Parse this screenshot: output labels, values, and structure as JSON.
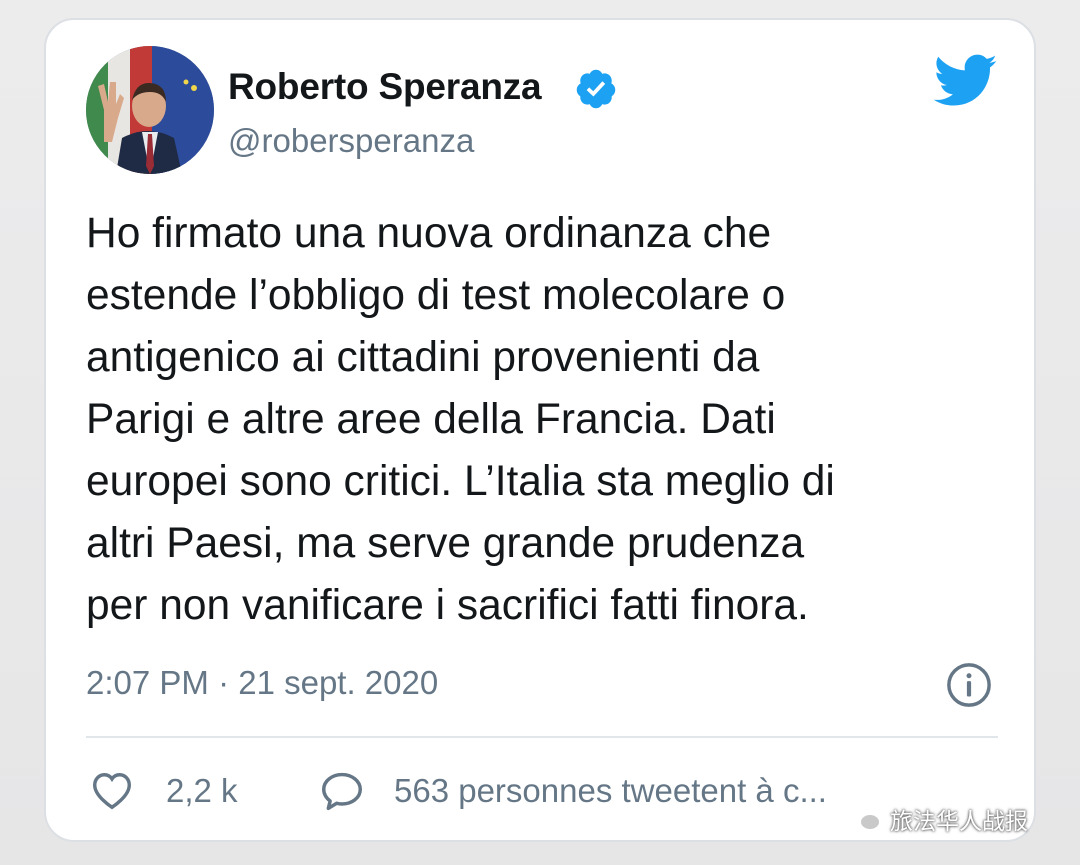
{
  "tweet": {
    "author_name": "Roberto Speranza",
    "handle": "@robersperanza",
    "text": "Ho firmato una nuova ordinanza che\nestende l’obbligo di test molecolare o\nantigenico ai cittadini provenienti da\nParigi e altre aree della Francia. Dati\neuropei sono critici. L’Italia sta meglio di\naltri Paesi, ma serve grande prudenza\nper non vanificare i sacrifici fatti finora.",
    "timestamp": "2:07 PM · 21 sept. 2020",
    "likes": "2,2 k",
    "replies_label": "563 personnes tweetent à c..."
  },
  "icons": {
    "verified": "verified-badge-icon",
    "platform": "twitter-bird-icon",
    "info": "info-icon",
    "like": "heart-icon",
    "reply": "reply-bubble-icon",
    "watermark": "wechat-icon"
  },
  "watermark": {
    "text": "旅法华人战报"
  },
  "colors": {
    "twitter_blue": "#1da1f2",
    "text": "#14171a",
    "secondary": "#657786",
    "card_border": "#dcdfe3"
  }
}
